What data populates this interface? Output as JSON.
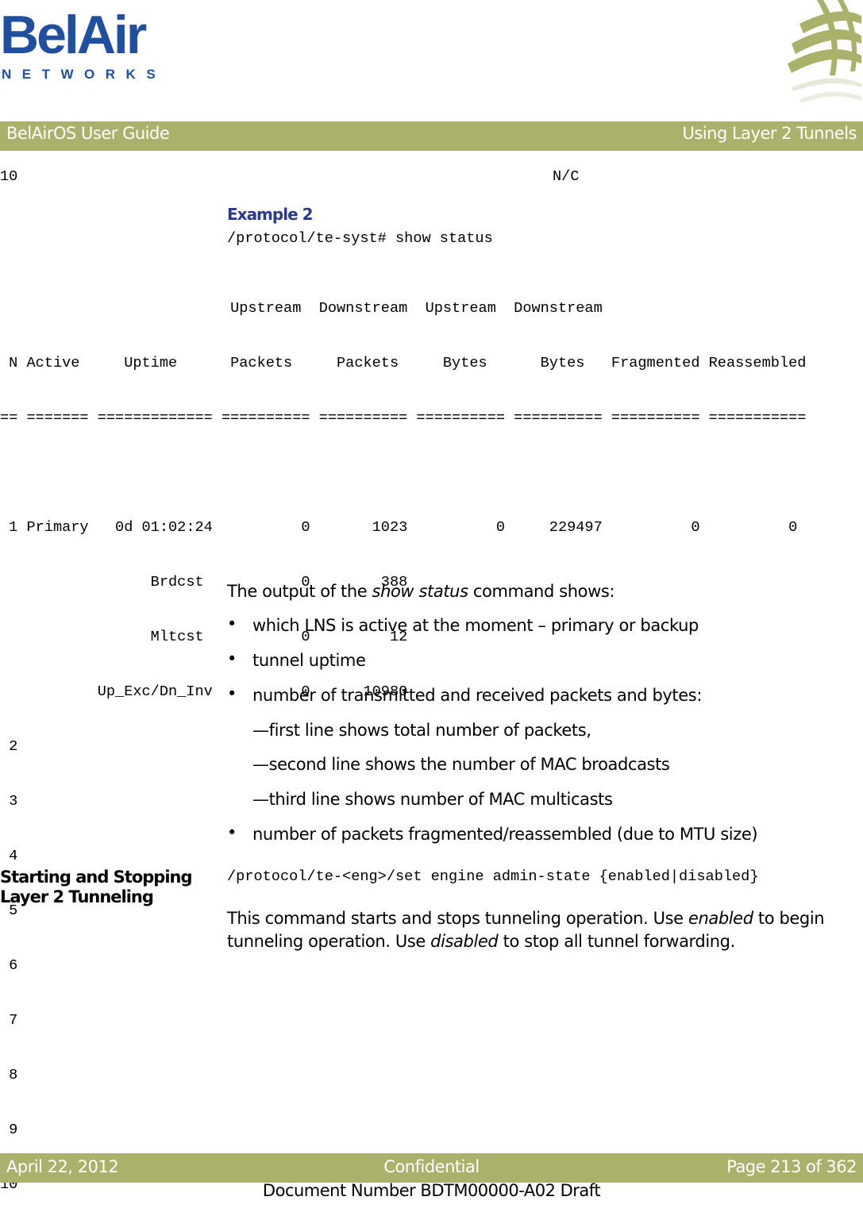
{
  "logo": {
    "name": "BelAir",
    "subtitle": "NETWORKS"
  },
  "header": {
    "left": "BelAirOS User Guide",
    "right": "Using Layer 2 Tunnels"
  },
  "prev_output_line": {
    "n": "10",
    "value": "N/C"
  },
  "example": {
    "heading": "Example 2",
    "command": "/protocol/te-syst# show status",
    "table": {
      "header_line1": "                          Upstream  Downstream  Upstream  Downstream",
      "header_line2": " N Active     Uptime      Packets     Packets     Bytes      Bytes   Fragmented Reassembled",
      "separator": "== ======= ============= ========== ========== ========== ========== ========== ===========",
      "rows": [
        " 1 Primary   0d 01:02:24          0       1023          0     229497          0          0",
        "                 Brdcst           0        388",
        "                 Mltcst           0         12",
        "           Up_Exc/Dn_Inv          0      10980",
        " 2",
        " 3",
        " 4",
        " 5",
        " 6",
        " 7",
        " 8",
        " 9",
        "10"
      ]
    }
  },
  "description": {
    "intro_before": "The output of the ",
    "intro_italic": "show status",
    "intro_after": " command shows:",
    "bullets": [
      "which LNS is active at the moment – primary or backup",
      "tunnel uptime",
      "number of transmitted and received packets and bytes:"
    ],
    "sub_items": [
      "—first line shows total number of packets,",
      "—second line shows the number of MAC broadcasts",
      "—third line shows number of MAC multicasts"
    ],
    "last_bullet": "number of packets fragmented/reassembled (due to MTU size)"
  },
  "section": {
    "heading_line1": "Starting and Stopping",
    "heading_line2": "Layer 2 Tunneling",
    "command": "/protocol/te-<eng>/set engine admin-state {enabled|disabled}",
    "p1": "This command starts and stops tunneling operation. Use ",
    "p1_italic": "enabled",
    "p2": " to begin tunneling operation. Use ",
    "p2_italic": "disabled",
    "p3": " to stop all tunnel forwarding."
  },
  "footer": {
    "date": "April 22, 2012",
    "classification": "Confidential",
    "page": "Page 213 of 362",
    "doc_number": "Document Number BDTM00000-A02 Draft"
  }
}
